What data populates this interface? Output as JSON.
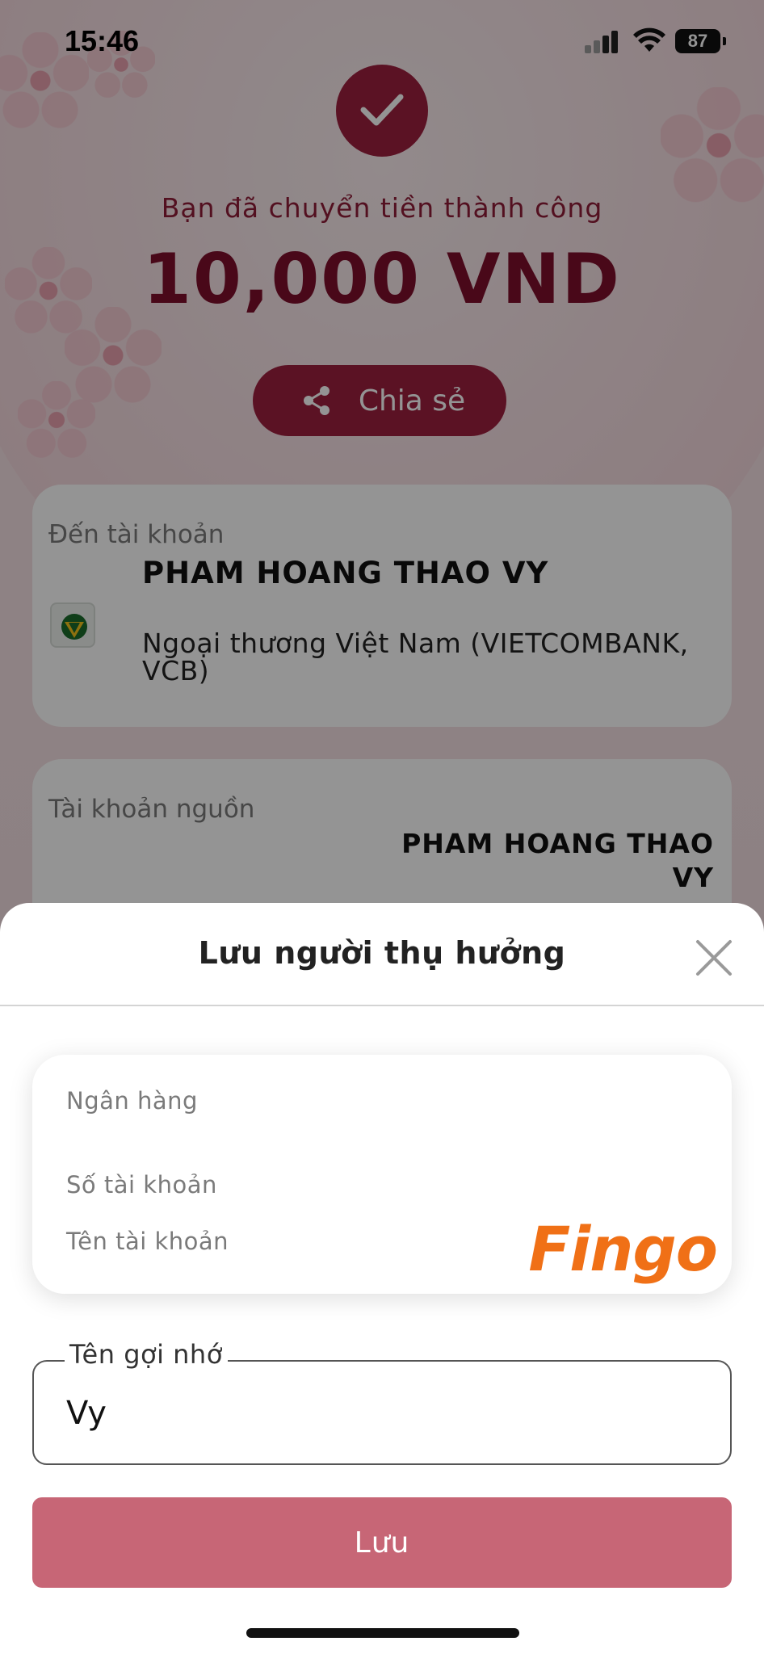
{
  "status_bar": {
    "time": "15:46",
    "battery": "87"
  },
  "result": {
    "message": "Bạn đã chuyển tiền thành công",
    "amount": "10,000 VND",
    "share_label": "Chia sẻ"
  },
  "destination": {
    "label": "Đến tài khoản",
    "name": "PHAM HOANG THAO VY",
    "bank": "Ngoại thương Việt Nam (VIETCOMBANK, VCB)"
  },
  "source": {
    "label": "Tài khoản nguồn",
    "name": "PHAM HOANG THAO VY"
  },
  "sheet": {
    "title": "Lưu người thụ hưởng",
    "bank_label": "Ngân hàng",
    "account_number_label": "Số tài khoản",
    "account_name_label": "Tên tài khoản",
    "brand": "Fingo",
    "nickname_label": "Tên gợi nhớ",
    "nickname_value": "Vy",
    "save_label": "Lưu"
  },
  "colors": {
    "brand_red": "#9e1f3f",
    "save_button": "#c76676",
    "fingo_orange": "#f07016"
  }
}
